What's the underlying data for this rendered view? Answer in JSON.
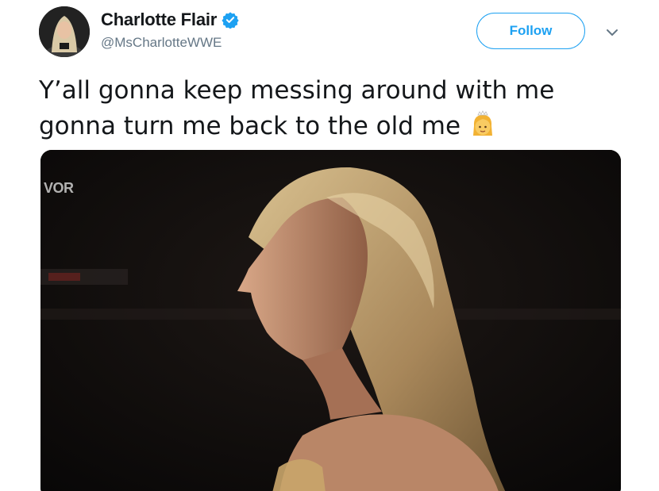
{
  "user": {
    "display_name": "Charlotte Flair",
    "handle": "@MsCharlotteWWE",
    "verified": true,
    "avatar_icon": "avatar-photo"
  },
  "actions": {
    "follow_label": "Follow",
    "more_icon": "chevron-down-icon"
  },
  "tweet": {
    "text_line1": "Y’all gonna keep messing around with me",
    "text_line2": "gonna turn me back to the old me",
    "emoji": "princess-emoji"
  },
  "media": {
    "description_icon": "photo",
    "watermark": "VOR"
  },
  "colors": {
    "accent": "#1da1f2",
    "secondary_text": "#657786",
    "primary_text": "#14171a"
  }
}
